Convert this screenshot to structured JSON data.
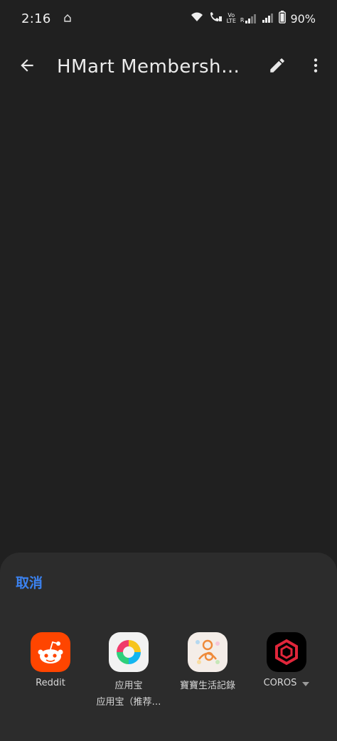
{
  "status_bar": {
    "time": "2:16",
    "battery": "90%",
    "volte_line1": "Vo",
    "volte_line2": "LTE",
    "sim_r": "R"
  },
  "app_bar": {
    "title": "HMart Membershi…",
    "back_icon": "arrow-left-icon",
    "edit_icon": "pencil-icon",
    "more_icon": "more-vertical-icon"
  },
  "share_sheet": {
    "cancel_label": "取消",
    "apps": [
      {
        "label": "Reddit",
        "sublabel": "",
        "icon": "reddit-icon",
        "color": "#ff4500"
      },
      {
        "label": "应用宝",
        "sublabel": "应用宝（推荐…",
        "icon": "yingyongbao-icon",
        "color": "#ffffff"
      },
      {
        "label": "寶寶生活記錄",
        "sublabel": "",
        "icon": "baby-log-icon",
        "color": "#f4ede8"
      },
      {
        "label": "COROS",
        "sublabel": "",
        "icon": "coros-icon",
        "color": "#000000"
      }
    ]
  },
  "colors": {
    "background": "#202020",
    "sheet": "#2c2c2c",
    "accent": "#3b82f0"
  }
}
